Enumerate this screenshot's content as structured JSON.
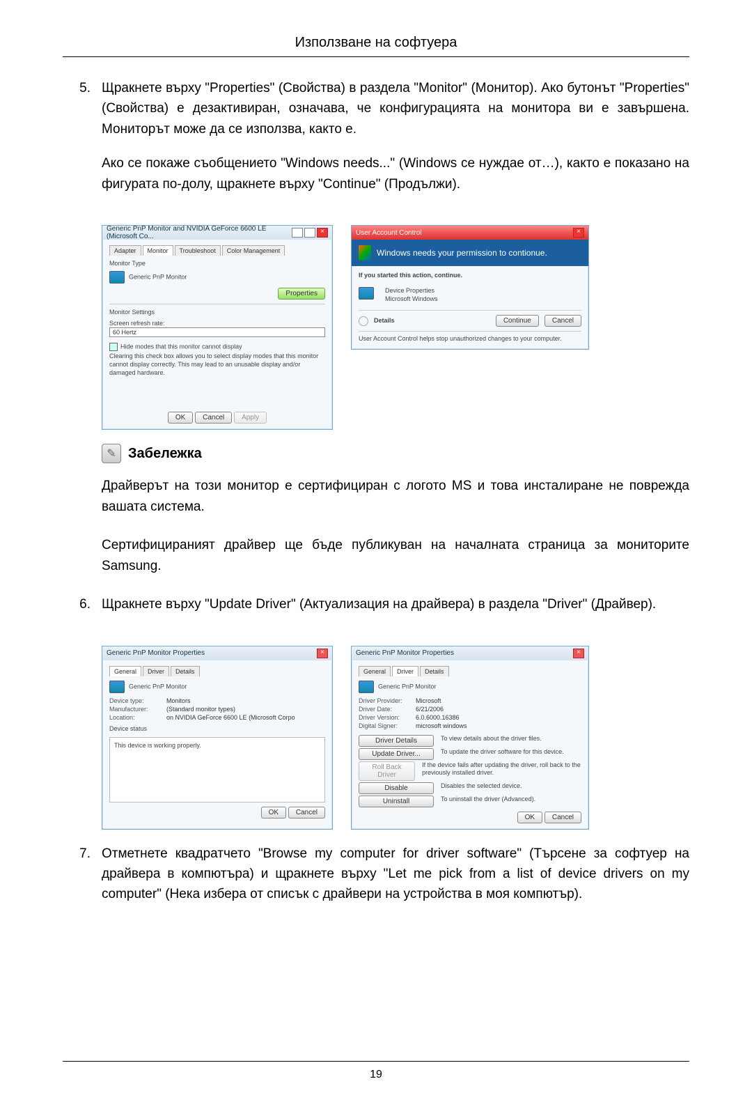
{
  "header": {
    "title": "Използване на софтуера"
  },
  "steps": {
    "s5": {
      "num": "5.",
      "p1": "Щракнете върху \"Properties\" (Свойства) в раздела \"Monitor\" (Монитор). Ако бутонът \"Properties\" (Свойства) е дезактивиран, означава, че конфигурацията на монитора ви е завършена. Мониторът може да се използва, както е.",
      "p2": "Ако се покаже съобщението \"Windows needs...\" (Windows се нуждае от…), както е показано на фигурата по-долу, щракнете върху \"Continue\" (Продължи)."
    },
    "s6": {
      "num": "6.",
      "p1": "Щракнете върху \"Update Driver\" (Актуализация на драйвера) в раздела \"Driver\" (Драйвер)."
    },
    "s7": {
      "num": "7.",
      "p1": "Отметнете квадратчето \"Browse my computer for driver software\" (Търсене за софтуер на драйвера в компютъра) и щракнете върху \"Let me pick from a list of device drivers on my computer\" (Нека избера от списък с драйвери на устройства в моя компютър)."
    }
  },
  "note": {
    "title": "Забележка",
    "p1": "Драйверът на този монитор е сертифициран с логото MS и това инсталиране не поврежда вашата система.",
    "p2": "Сертифицираният драйвер ще бъде публикуван на началната страница за мониторите Samsung."
  },
  "screenshotsA": {
    "left": {
      "title": "Generic PnP Monitor and NVIDIA GeForce 6600 LE (Microsoft Co...",
      "tabs": [
        "Adapter",
        "Monitor",
        "Troubleshoot",
        "Color Management"
      ],
      "monitorTypeLabel": "Monitor Type",
      "monitorName": "Generic PnP Monitor",
      "propertiesBtn": "Properties",
      "settingsLabel": "Monitor Settings",
      "refreshLabel": "Screen refresh rate:",
      "refreshValue": "60 Hertz",
      "hideModes": "Hide modes that this monitor cannot display",
      "hideModesDesc": "Clearing this check box allows you to select display modes that this monitor cannot display correctly. This may lead to an unusable display and/or damaged hardware.",
      "ok": "OK",
      "cancel": "Cancel",
      "apply": "Apply"
    },
    "right": {
      "title": "User Account Control",
      "headline": "Windows needs your permission to contionue.",
      "ifStarted": "If you started this action, continue.",
      "devProps": "Device Properties",
      "msWin": "Microsoft Windows",
      "details": "Details",
      "continue": "Continue",
      "cancel": "Cancel",
      "footer": "User Account Control helps stop unauthorized changes to your computer."
    }
  },
  "screenshotsB": {
    "left": {
      "title": "Generic PnP Monitor Properties",
      "tabs": [
        "General",
        "Driver",
        "Details"
      ],
      "monitorName": "Generic PnP Monitor",
      "rows": {
        "type": "Device type:",
        "typeV": "Monitors",
        "manu": "Manufacturer:",
        "manuV": "(Standard monitor types)",
        "loc": "Location:",
        "locV": "on NVIDIA GeForce 6600 LE (Microsoft Corpo"
      },
      "statusLbl": "Device status",
      "statusTxt": "This device is working properly.",
      "ok": "OK",
      "cancel": "Cancel"
    },
    "right": {
      "title": "Generic PnP Monitor Properties",
      "tabs": [
        "General",
        "Driver",
        "Details"
      ],
      "monitorName": "Generic PnP Monitor",
      "rows": {
        "prov": "Driver Provider:",
        "provV": "Microsoft",
        "date": "Driver Date:",
        "dateV": "6/21/2006",
        "ver": "Driver Version:",
        "verV": "6.0.6000.16386",
        "sign": "Digital Signer:",
        "signV": "microsoft windows"
      },
      "buttons": {
        "details": "Driver Details",
        "detailsD": "To view details about the driver files.",
        "update": "Update Driver...",
        "updateD": "To update the driver software for this device.",
        "roll": "Roll Back Driver",
        "rollD": "If the device fails after updating the driver, roll back to the previously installed driver.",
        "disable": "Disable",
        "disableD": "Disables the selected device.",
        "uninstall": "Uninstall",
        "uninstallD": "To uninstall the driver (Advanced)."
      },
      "ok": "OK",
      "cancel": "Cancel"
    }
  },
  "pageNumber": "19"
}
